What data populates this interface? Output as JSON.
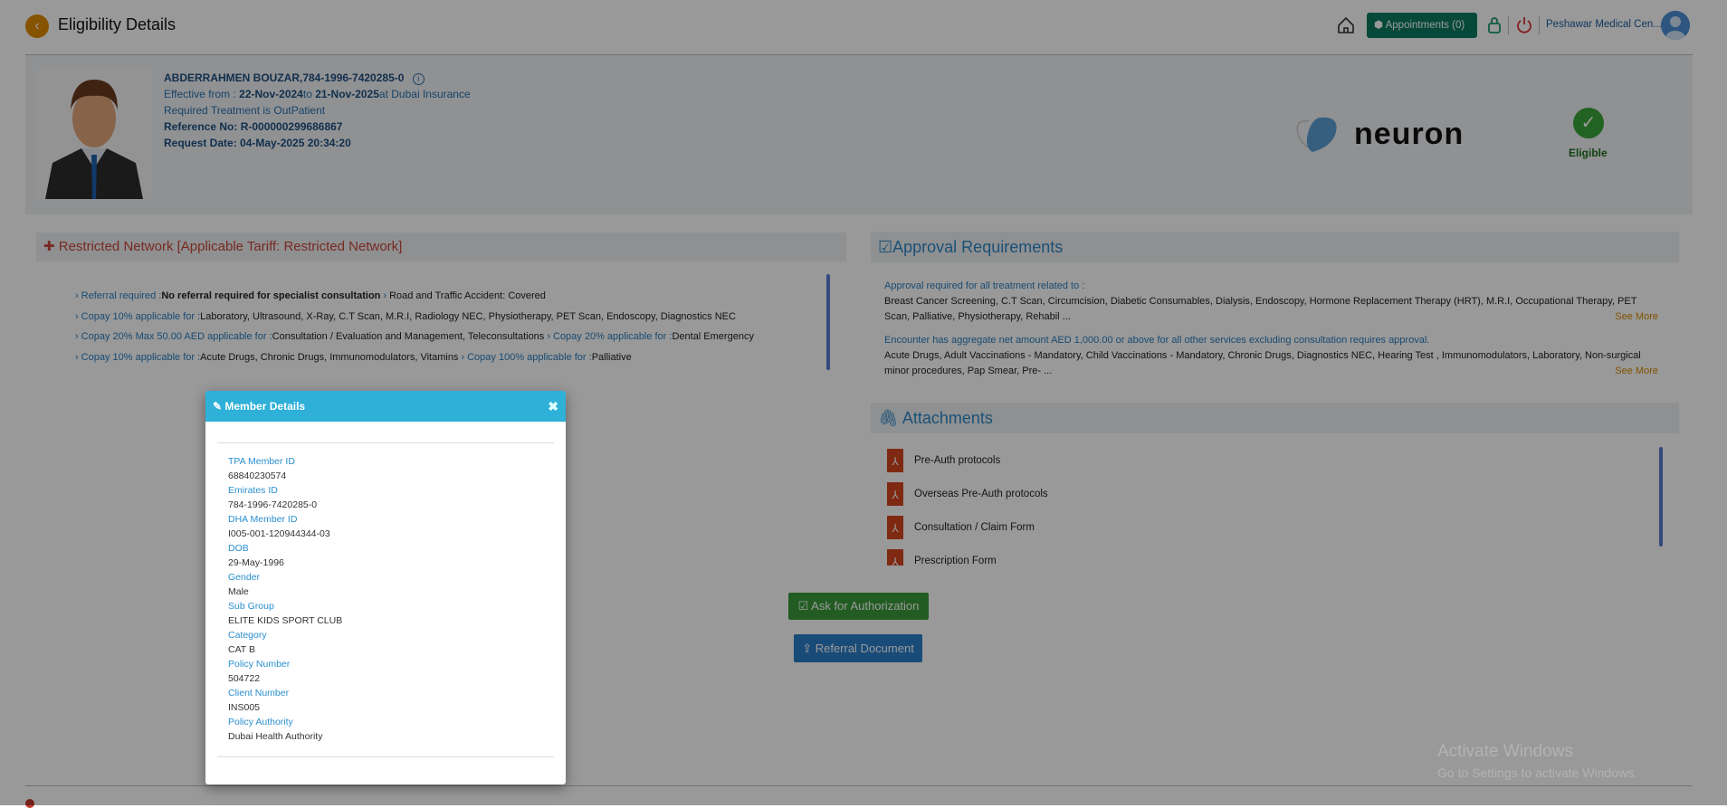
{
  "header": {
    "title": "Eligibility Details",
    "appointments_label": "Appointments (0)",
    "clinic_name": "Peshawar Medical Cen..."
  },
  "patient": {
    "name_id": "ABDERRAHMEN BOUZAR,784-1996-7420285-0",
    "effective_prefix": "Effective from : ",
    "effective_from": "22-Nov-2024",
    "to_label": "to ",
    "effective_to": "21-Nov-2025",
    "at_label": "at Dubai Insurance",
    "treatment": "Required Treatment is OutPatient",
    "reference": "Reference No: R-000000299686867",
    "request_date": "Request Date: 04-May-2025 20:34:20",
    "logo_text": "neuron",
    "status": "Eligible"
  },
  "network": {
    "title": "Restricted Network [Applicable Tariff: Restricted Network]",
    "rules": [
      [
        {
          "k": "Referral required :",
          "v": "No referral required for specialist consultation",
          "bold": true
        },
        {
          "k": "",
          "v": "Road and Traffic Accident: Covered"
        }
      ],
      [
        {
          "k": "Copay 10% applicable for :",
          "v": "Laboratory, Ultrasound, X-Ray, C.T Scan, M.R.I, Radiology NEC, Physiotherapy, PET Scan, Endoscopy, Diagnostics NEC"
        }
      ],
      [
        {
          "k": "Copay 20% Max 50.00 AED applicable for :",
          "v": "Consultation / Evaluation and Management, Teleconsultations"
        },
        {
          "k": "Copay 20% applicable for :",
          "v": "Dental Emergency"
        }
      ],
      [
        {
          "k": "Copay 10% applicable for :",
          "v": "Acute Drugs, Chronic Drugs, Immunomodulators, Vitamins"
        },
        {
          "k": "Copay 100% applicable for :",
          "v": "Palliative"
        }
      ]
    ]
  },
  "approval": {
    "title": "Approval Requirements",
    "blocks": [
      {
        "heading": "Approval required for all treatment related to :",
        "text": "Breast Cancer Screening, C.T Scan, Circumcision, Diabetic Consumables, Dialysis, Endoscopy, Hormone Replacement Therapy (HRT), M.R.I, Occupational Therapy, PET Scan, Palliative, Physiotherapy, Rehabil ...",
        "more": "See More"
      },
      {
        "heading": "Encounter has aggregate net amount AED 1,000.00 or above for all other services excluding consultation requires approval.",
        "text": "Acute Drugs, Adult Vaccinations - Mandatory, Child Vaccinations - Mandatory, Chronic Drugs, Diagnostics NEC, Hearing Test , Immunomodulators, Laboratory, Non-surgical minor procedures, Pap Smear, Pre- ...",
        "more": "See More"
      }
    ]
  },
  "attachments": {
    "title": "Attachments",
    "items": [
      "Pre-Auth protocols",
      "Overseas Pre-Auth protocols",
      "Consultation / Claim Form",
      "Prescription Form"
    ]
  },
  "actions": {
    "ask": "Ask for Authorization",
    "referral": "Referral Document"
  },
  "watermark": {
    "line1": "Activate Windows",
    "line2": "Go to Settings to activate Windows."
  },
  "modal": {
    "title": "Member Details",
    "fields": [
      {
        "label": "TPA Member ID",
        "value": "68840230574"
      },
      {
        "label": "Emirates ID",
        "value": "784-1996-7420285-0"
      },
      {
        "label": "DHA Member ID",
        "value": "I005-001-120944344-03"
      },
      {
        "label": "DOB",
        "value": "29-May-1996"
      },
      {
        "label": "Gender",
        "value": "Male"
      },
      {
        "label": "Sub Group",
        "value": "ELITE KIDS SPORT CLUB"
      },
      {
        "label": "Category",
        "value": "CAT B"
      },
      {
        "label": "Policy Number",
        "value": "504722"
      },
      {
        "label": "Client Number",
        "value": "INS005"
      },
      {
        "label": "Policy Authority",
        "value": "Dubai Health Authority"
      }
    ]
  }
}
